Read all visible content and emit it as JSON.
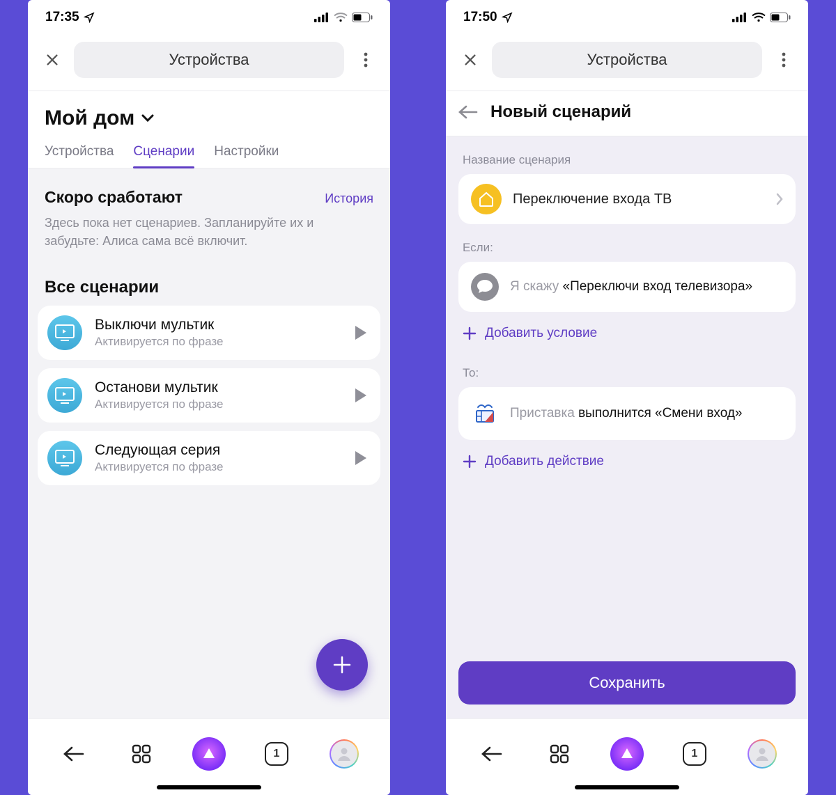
{
  "left": {
    "status": {
      "time": "17:35"
    },
    "header": {
      "title": "Устройства"
    },
    "home": {
      "title": "Мой дом"
    },
    "tabs": [
      "Устройства",
      "Сценарии",
      "Настройки"
    ],
    "soon": {
      "title": "Скоро сработают",
      "history": "История",
      "desc": "Здесь пока нет сценариев. Запланируйте их и забудьте: Алиса сама всё включит."
    },
    "all_title": "Все сценарии",
    "scenarios": [
      {
        "title": "Выключи мультик",
        "sub": "Активируется по фразе"
      },
      {
        "title": "Останови мультик",
        "sub": "Активируется по фразе"
      },
      {
        "title": "Следующая серия",
        "sub": "Активируется по фразе"
      }
    ]
  },
  "right": {
    "status": {
      "time": "17:50"
    },
    "header": {
      "title": "Устройства"
    },
    "sub_title": "Новый сценарий",
    "name_label": "Название сценария",
    "name_value": "Переключение входа ТВ",
    "if_label": "Если:",
    "if_prefix": "Я скажу",
    "if_phrase": "«Переключи вход телевизора»",
    "add_condition": "Добавить условие",
    "then_label": "То:",
    "then_device": "Приставка",
    "then_rest": "выполнится «Смени вход»",
    "add_action": "Добавить действие",
    "save": "Сохранить"
  },
  "nav": {
    "tab_count": "1"
  }
}
